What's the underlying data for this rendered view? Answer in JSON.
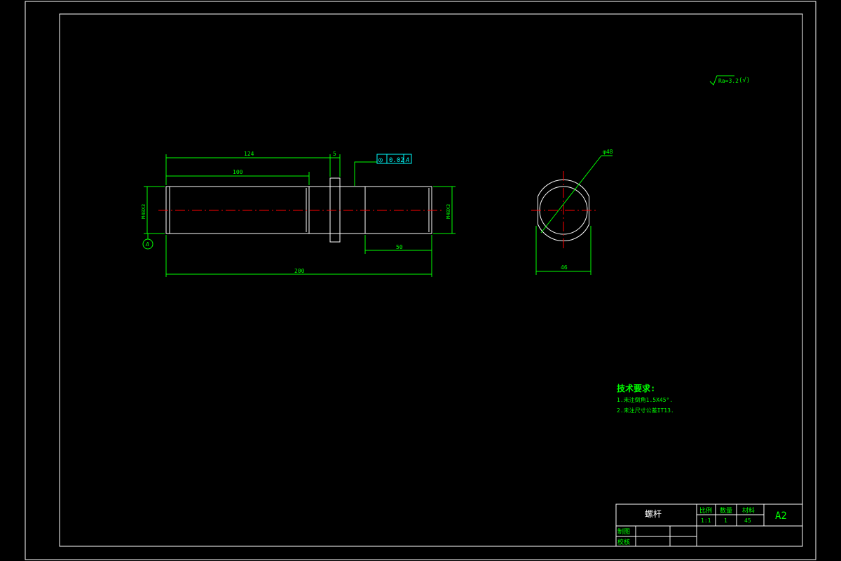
{
  "drawing": {
    "colors": {
      "background": "#000000",
      "outline": "#ffffff",
      "dimension": "#00ff00",
      "tolerance": "#00ffff",
      "centerline": "#ff0000",
      "title_text": "#00ff00"
    },
    "surface_roughness": {
      "text": "Ra=3.2",
      "suffix": "(√)"
    },
    "dimensions": {
      "d124": "124",
      "d5": "5",
      "d100": "100",
      "d50": "50",
      "d200": "200",
      "left_dia": "M48X3",
      "right_dia": "M48X3",
      "end_dia": "φ48",
      "end_width": "46"
    },
    "datum": {
      "label": "A"
    },
    "tolerance_frame": {
      "symbol": "◎",
      "value": "0.02",
      "datum": "A"
    },
    "tech_requirements": {
      "title": "技术要求:",
      "items": [
        "1.未注倒角1.5X45°.",
        "2.未注尺寸公差IT13."
      ]
    },
    "title_block": {
      "part_name": "螺杆",
      "scale_label": "比例",
      "quantity_label": "数量",
      "material_label": "材料",
      "scale_value": "1:1",
      "quantity_value": "1",
      "material_value": "45",
      "sheet_size": "A2",
      "drawn_by_label": "制图",
      "checked_by_label": "校核"
    }
  }
}
